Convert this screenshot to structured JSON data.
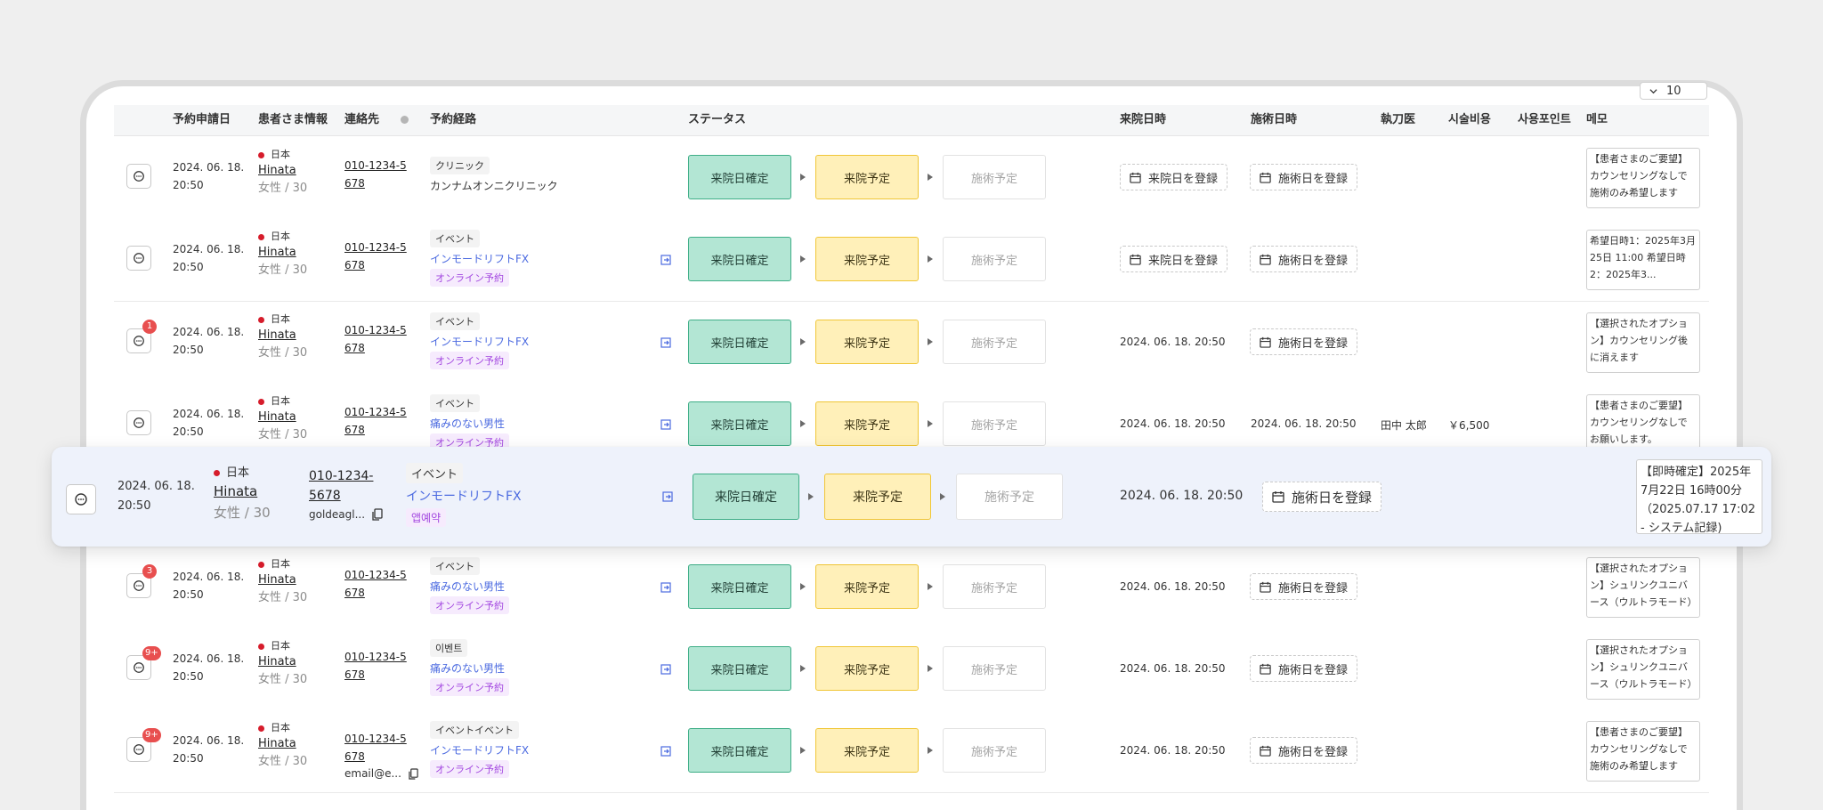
{
  "page_size": {
    "value": "10"
  },
  "headers": {
    "applied": "予約申請日",
    "patient": "患者さま情報",
    "contact": "連絡先",
    "route": "予約経路",
    "status": "ステータス",
    "visit_date": "来院日時",
    "treat_date": "施術日時",
    "doctor": "執刀医",
    "cost": "시술비용",
    "points": "사용포인트",
    "memo": "메모"
  },
  "labels": {
    "nation": "日本",
    "name": "Hinata",
    "gender": "女性 / 30",
    "phone": "010-1234-5678",
    "status1": "来院日確定",
    "status2": "来院予定",
    "status3": "施術予定",
    "register_visit": "来院日を登録",
    "register_treat": "施術日を登録",
    "date": "2024. 06. 18. 20:50",
    "date_line1": "2024. 06. 18.",
    "date_line2": "20:50"
  },
  "rows": [
    {
      "badge": "",
      "route_type": "クリニック",
      "route_name": "カンナムオンニクリニック",
      "route_tag": "",
      "visit": "",
      "treat": "",
      "doctor": "",
      "cost": "",
      "email": "",
      "memo": "【患者さまのご要望】カウンセリングなしで施術のみ希望します"
    },
    {
      "badge": "",
      "route_type": "イベント",
      "route_name": "インモードリフトFX",
      "route_tag": "オンライン予約",
      "visit": "",
      "treat": "",
      "doctor": "",
      "cost": "",
      "email": "",
      "memo": "希望日時1：2025年3月25日 11:00\n希望日時2：2025年3..."
    },
    {
      "badge": "1",
      "route_type": "イベント",
      "route_name": "インモードリフトFX",
      "route_tag": "オンライン予約",
      "visit": "2024. 06. 18. 20:50",
      "treat": "",
      "doctor": "",
      "cost": "",
      "email": "",
      "memo": "【選択されたオプション】カウンセリング後に消えます"
    },
    {
      "badge": "",
      "route_type": "イベント",
      "route_name": "痛みのない男性",
      "route_tag": "オンライン予約",
      "visit": "2024. 06. 18. 20:50",
      "treat": "2024. 06. 18. 20:50",
      "doctor": "田中 太郎",
      "cost": "￥6,500",
      "email": "",
      "memo": "【患者さまのご要望】カウンセリングなしでお願いします。"
    },
    {
      "badge": "3",
      "route_type": "イベント",
      "route_name": "痛みのない男性",
      "route_tag": "オンライン予約",
      "visit": "2024. 06. 18. 20:50",
      "treat": "",
      "doctor": "",
      "cost": "",
      "email": "",
      "memo": "【選択されたオプション】シュリンクユニバース（ウルトラモード）_..."
    },
    {
      "badge": "9+",
      "route_type": "이벤트",
      "route_name": "痛みのない男性",
      "route_tag": "オンライン予約",
      "visit": "2024. 06. 18. 20:50",
      "treat": "",
      "doctor": "",
      "cost": "",
      "email": "",
      "memo": "【選択されたオプション】シュリンクユニバース（ウルトラモード）_..."
    },
    {
      "badge": "9+",
      "route_type": "イベントイベント",
      "route_name": "インモードリフトFX",
      "route_tag": "オンライン予約",
      "visit": "2024. 06. 18. 20:50",
      "treat": "",
      "doctor": "",
      "cost": "",
      "email": "email@e...",
      "memo": "【患者さまのご要望】カウンセリングなしで施術のみ希望します"
    }
  ],
  "highlight": {
    "route_type": "イベント",
    "route_name": "インモードリフトFX",
    "route_tag": "앱예약",
    "visit": "2024. 06. 18. 20:50",
    "email": "goldeagl...",
    "memo": "【即時確定】2025年7月22日 16時00分\n（2025.07.17 17:02 - システム記録)"
  }
}
